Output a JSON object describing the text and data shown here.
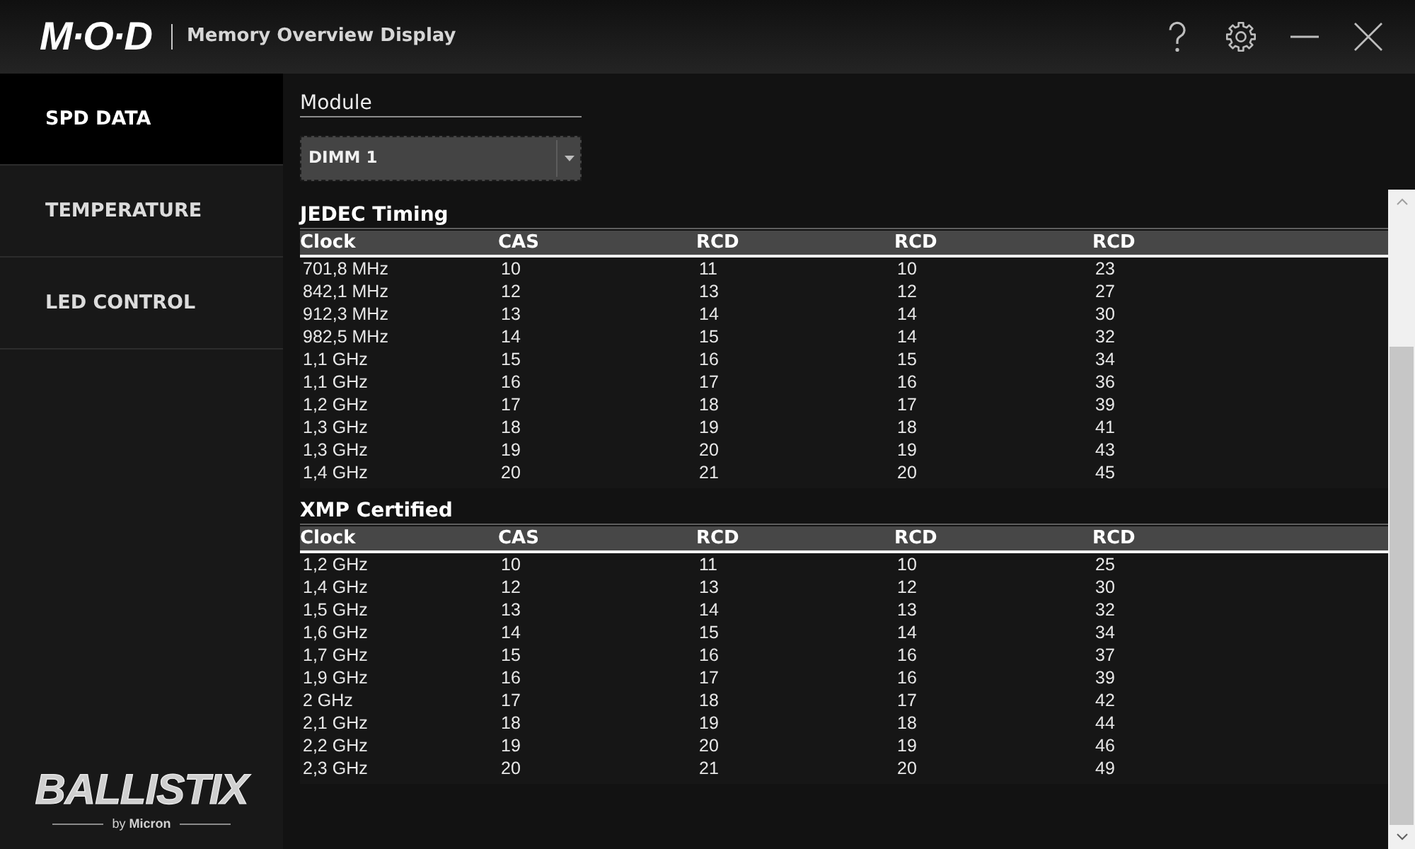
{
  "window": {
    "logo": "M·O·D",
    "title": "Memory Overview Display"
  },
  "sidebar": {
    "items": [
      {
        "label": "SPD DATA",
        "selected": true
      },
      {
        "label": "TEMPERATURE",
        "selected": false
      },
      {
        "label": "LED CONTROL",
        "selected": false
      }
    ],
    "brand": {
      "wordmark": "BALLISTIX",
      "byline": "by **Micron**"
    }
  },
  "module": {
    "label": "Module",
    "value": "DIMM 1"
  },
  "tables": [
    {
      "title": "JEDEC Timing",
      "columns": [
        "Clock",
        "CAS",
        "RCD",
        "RCD",
        "RCD"
      ],
      "rows": [
        [
          "701,8 MHz",
          "10",
          "11",
          "10",
          "23"
        ],
        [
          "842,1 MHz",
          "12",
          "13",
          "12",
          "27"
        ],
        [
          "912,3 MHz",
          "13",
          "14",
          "14",
          "30"
        ],
        [
          "982,5 MHz",
          "14",
          "15",
          "14",
          "32"
        ],
        [
          "1,1 GHz",
          "15",
          "16",
          "15",
          "34"
        ],
        [
          "1,1 GHz",
          "16",
          "17",
          "16",
          "36"
        ],
        [
          "1,2 GHz",
          "17",
          "18",
          "17",
          "39"
        ],
        [
          "1,3 GHz",
          "18",
          "19",
          "18",
          "41"
        ],
        [
          "1,3 GHz",
          "19",
          "20",
          "19",
          "43"
        ],
        [
          "1,4 GHz",
          "20",
          "21",
          "20",
          "45"
        ]
      ]
    },
    {
      "title": "XMP Certified",
      "columns": [
        "Clock",
        "CAS",
        "RCD",
        "RCD",
        "RCD"
      ],
      "rows": [
        [
          "1,2 GHz",
          "10",
          "11",
          "10",
          "25"
        ],
        [
          "1,4 GHz",
          "12",
          "13",
          "12",
          "30"
        ],
        [
          "1,5 GHz",
          "13",
          "14",
          "13",
          "32"
        ],
        [
          "1,6 GHz",
          "14",
          "15",
          "14",
          "34"
        ],
        [
          "1,7 GHz",
          "15",
          "16",
          "16",
          "37"
        ],
        [
          "1,9 GHz",
          "16",
          "17",
          "16",
          "39"
        ],
        [
          "2 GHz",
          "17",
          "18",
          "17",
          "42"
        ],
        [
          "2,1 GHz",
          "18",
          "19",
          "18",
          "44"
        ],
        [
          "2,2 GHz",
          "19",
          "20",
          "19",
          "46"
        ],
        [
          "2,3 GHz",
          "20",
          "21",
          "20",
          "49"
        ]
      ]
    }
  ]
}
